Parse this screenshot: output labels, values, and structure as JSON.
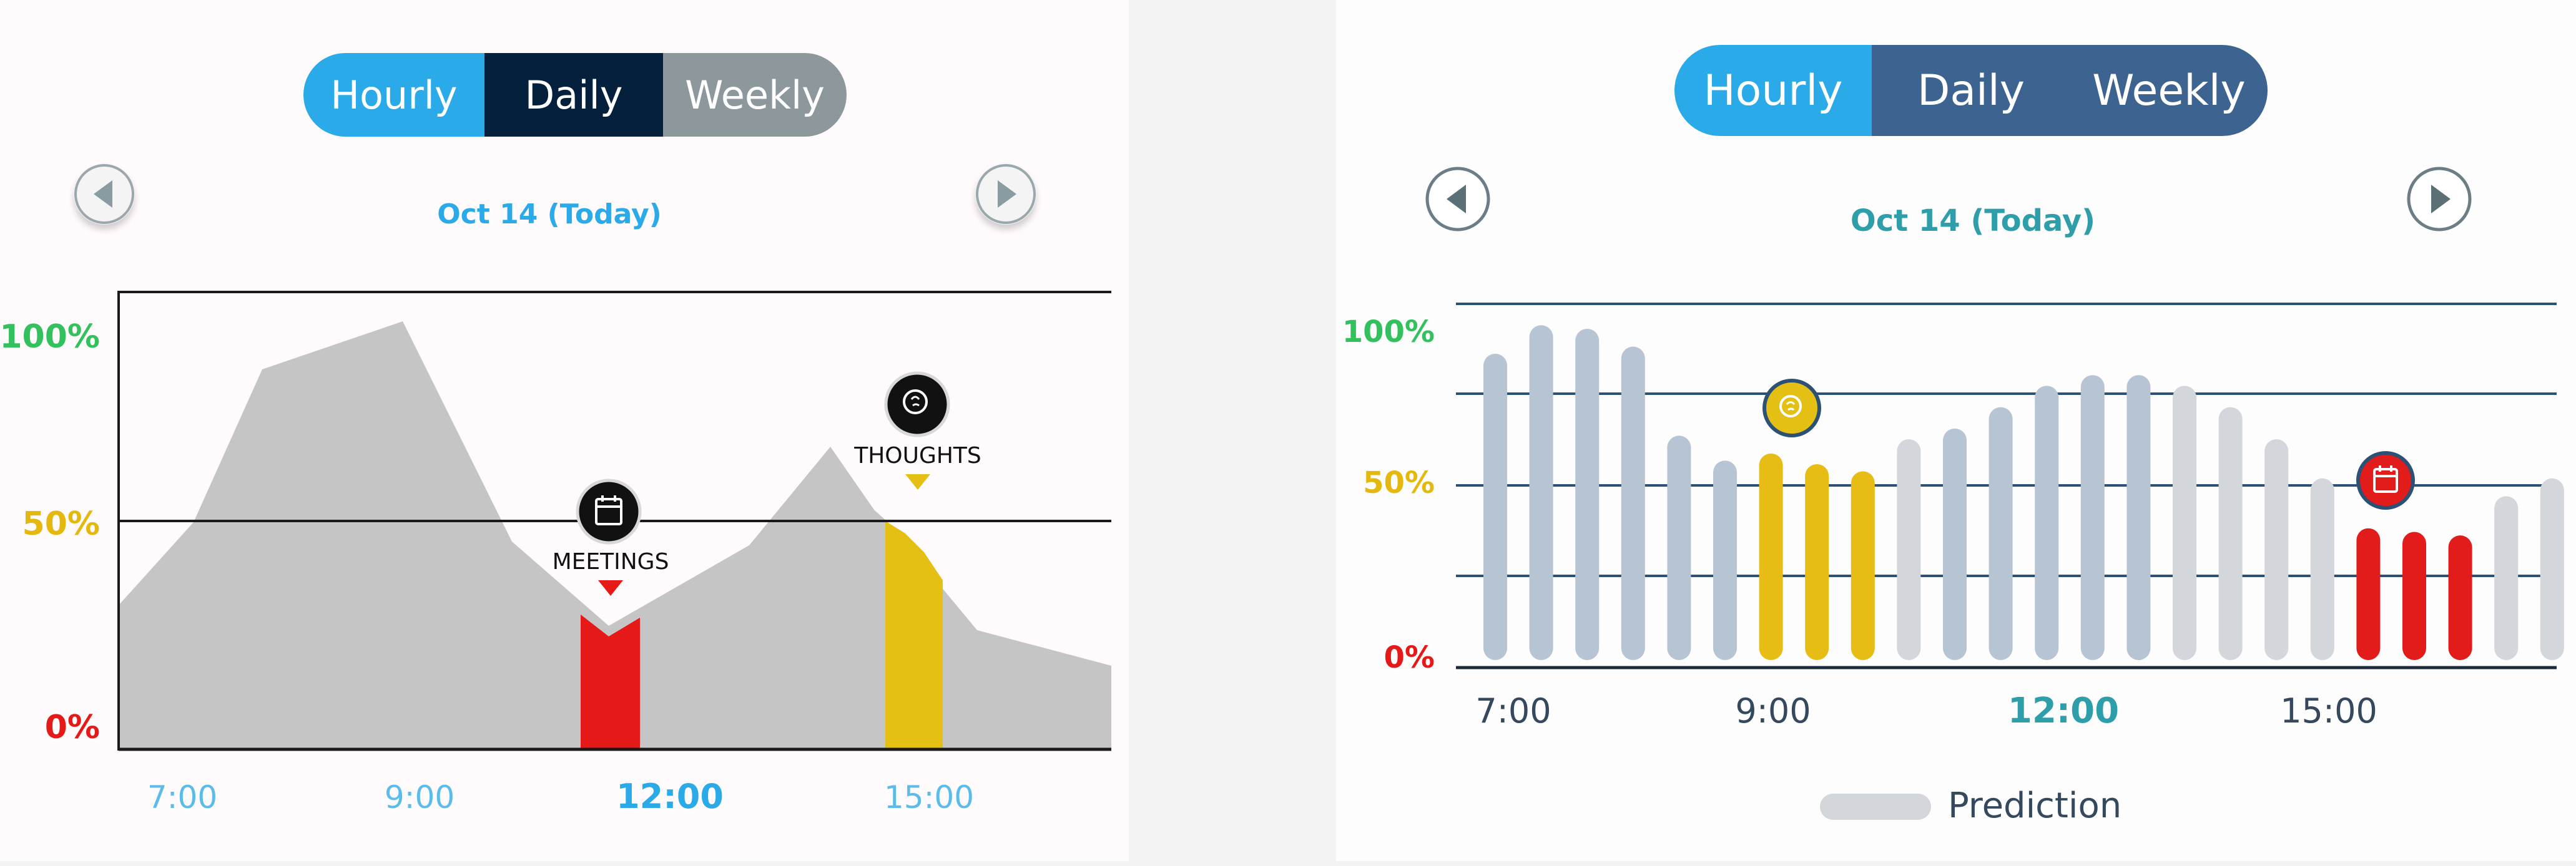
{
  "left_panel": {
    "tabs": [
      {
        "label": "Hourly",
        "color": "#2aaae9"
      },
      {
        "label": "Daily",
        "color": "#04203d"
      },
      {
        "label": "Weekly",
        "color": "#8d989d"
      }
    ],
    "date": "Oct 14 (Today)",
    "y_labels": [
      {
        "text": "100%",
        "color": "#33c15d"
      },
      {
        "text": "50%",
        "color": "#e4b80d"
      },
      {
        "text": "0%",
        "color": "#e61919"
      }
    ],
    "x_labels": [
      "7:00",
      "9:00",
      "12:00",
      "15:00"
    ],
    "markers": {
      "meetings": "MEETINGS",
      "thoughts": "THOUGHTS"
    }
  },
  "right_panel": {
    "tabs": [
      {
        "label": "Hourly",
        "color": "#2aaae9"
      },
      {
        "label": "Daily",
        "color": "#3d6391"
      },
      {
        "label": "Weekly",
        "color": "#3d6391"
      }
    ],
    "date": "Oct 14 (Today)",
    "y_labels": [
      {
        "text": "100%",
        "color": "#33c15d"
      },
      {
        "text": "50%",
        "color": "#e4b80d"
      },
      {
        "text": "0%",
        "color": "#e61919"
      }
    ],
    "x_labels": [
      "7:00",
      "9:00",
      "12:00",
      "15:00"
    ],
    "legend": "Prediction"
  },
  "chart_data": [
    {
      "type": "area",
      "x": [
        "6:30",
        "7:00",
        "8:00",
        "9:00",
        "10:00",
        "11:00",
        "12:00",
        "13:00",
        "14:00",
        "14:30",
        "15:00",
        "16:00",
        "17:00"
      ],
      "values": [
        30,
        50,
        88,
        96,
        45,
        27,
        45,
        70,
        52,
        45,
        25,
        20,
        20
      ],
      "highlights": [
        {
          "label": "MEETINGS",
          "color": "#e61919"
        },
        {
          "label": "THOUGHTS",
          "color": "#e4c015"
        }
      ],
      "y_ticks": [
        "0%",
        "50%",
        "100%"
      ],
      "ylim": [
        0,
        100
      ],
      "grid": false
    },
    {
      "type": "bar",
      "values": [
        86,
        94,
        93,
        88,
        63,
        56,
        58,
        55,
        53,
        62,
        65,
        71,
        77,
        80,
        80,
        77,
        71,
        62,
        51,
        37,
        36,
        35,
        46,
        51
      ],
      "kinds": [
        "actual",
        "actual",
        "actual",
        "actual",
        "actual",
        "actual",
        "thought",
        "thought",
        "thought",
        "prediction",
        "actual",
        "actual",
        "actual",
        "actual",
        "actual",
        "prediction",
        "prediction",
        "prediction",
        "prediction",
        "meeting",
        "meeting",
        "meeting",
        "prediction",
        "prediction"
      ],
      "colors": {
        "actual": "#b7c4d4",
        "prediction": "#d3d6da",
        "thought": "#e7bd15",
        "meeting": "#e21b1b"
      },
      "y_ticks": [
        "0%",
        "50%",
        "100%"
      ],
      "ylim": [
        0,
        100
      ],
      "grid": true
    }
  ]
}
